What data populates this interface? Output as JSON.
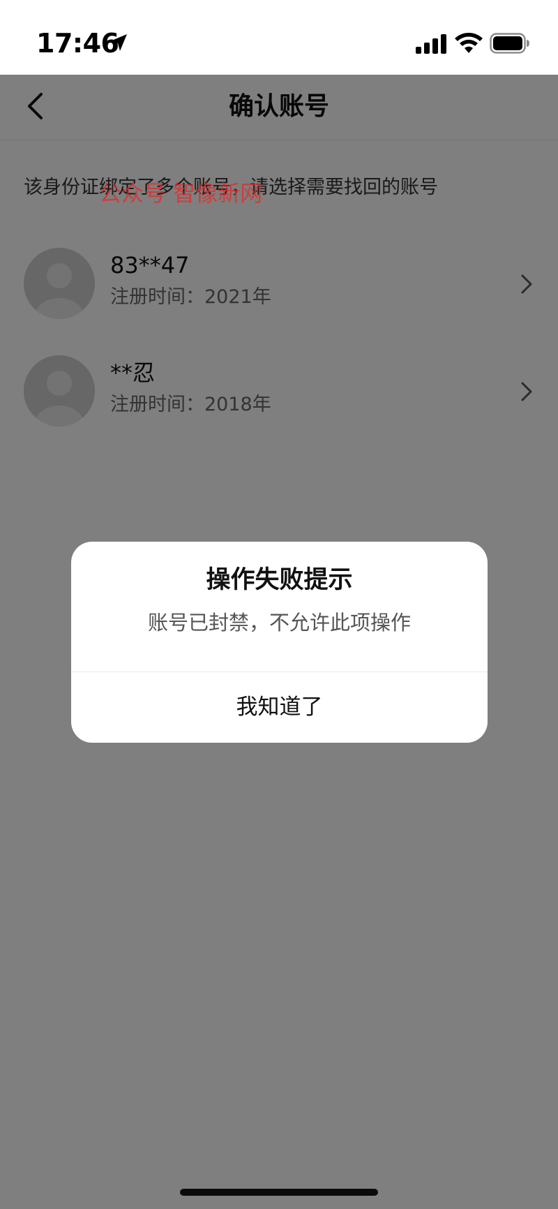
{
  "status_bar": {
    "time": "17:46"
  },
  "nav": {
    "title": "确认账号"
  },
  "hint": "该身份证绑定了多个账号，请选择需要找回的账号",
  "accounts": [
    {
      "name": "83**47",
      "registered": "注册时间：2021年"
    },
    {
      "name": "**忍",
      "registered": "注册时间：2018年"
    }
  ],
  "watermark": "公众号 智像新网",
  "dialog": {
    "title": "操作失败提示",
    "message": "账号已封禁，不允许此项操作",
    "button_label": "我知道了"
  },
  "icons": {
    "status": [
      "location-arrow-icon",
      "cellular-signal-icon",
      "wifi-icon",
      "battery-icon"
    ],
    "nav": [
      "back-chevron-icon"
    ],
    "list": [
      "avatar-placeholder-icon",
      "chevron-right-icon"
    ]
  },
  "colors": {
    "overlay": "#000000",
    "watermark": "#e62828",
    "background": "#ffffff",
    "text_primary": "#111111",
    "text_secondary": "#666666"
  }
}
